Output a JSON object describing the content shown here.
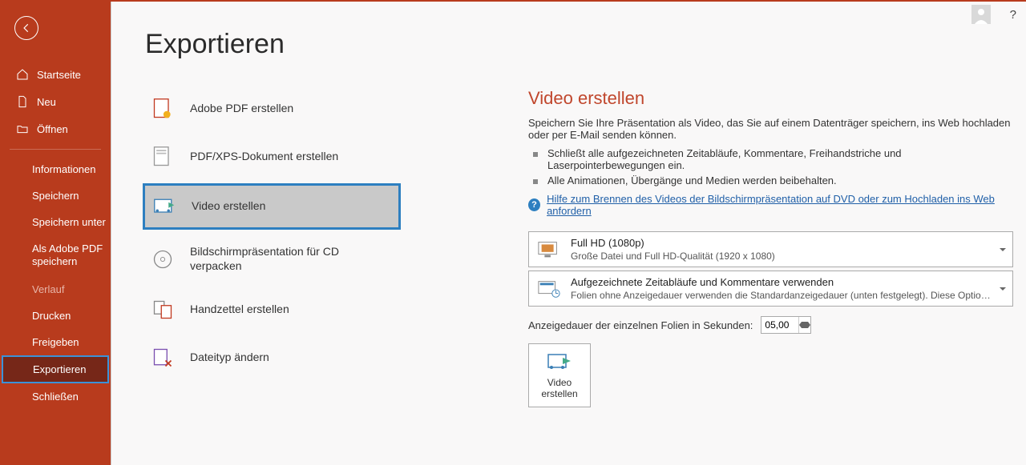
{
  "sidebar": {
    "items": [
      {
        "label": "Startseite"
      },
      {
        "label": "Neu"
      },
      {
        "label": "Öffnen"
      },
      {
        "label": "Informationen"
      },
      {
        "label": "Speichern"
      },
      {
        "label": "Speichern unter"
      },
      {
        "label": "Als Adobe PDF speichern"
      },
      {
        "label": "Verlauf"
      },
      {
        "label": "Drucken"
      },
      {
        "label": "Freigeben"
      },
      {
        "label": "Exportieren"
      },
      {
        "label": "Schließen"
      }
    ]
  },
  "page": {
    "title": "Exportieren"
  },
  "exportOptions": [
    {
      "label": "Adobe PDF erstellen"
    },
    {
      "label": "PDF/XPS-Dokument erstellen"
    },
    {
      "label": "Video erstellen"
    },
    {
      "label": "Bildschirmpräsentation für CD verpacken"
    },
    {
      "label": "Handzettel erstellen"
    },
    {
      "label": "Dateityp ändern"
    }
  ],
  "panel": {
    "heading": "Video erstellen",
    "intro": "Speichern Sie Ihre Präsentation als Video, das Sie auf einem Datenträger speichern, ins Web hochladen oder per E-Mail senden können.",
    "bullet1": "Schließt alle aufgezeichneten Zeitabläufe, Kommentare, Freihandstriche und Laserpointerbewegungen ein.",
    "bullet2": "Alle Animationen, Übergänge und Medien werden beibehalten.",
    "helpLink": "Hilfe zum Brennen des Videos der Bildschirmpräsentation auf DVD oder zum Hochladen ins Web anfordern",
    "quality": {
      "title": "Full HD (1080p)",
      "sub": "Große Datei und Full HD-Qualität (1920 x 1080)"
    },
    "timings": {
      "title": "Aufgezeichnete Zeitabläufe und Kommentare verwenden",
      "sub": "Folien ohne Anzeigedauer verwenden die Standardanzeigedauer (unten festgelegt). Diese Option gilt auch für Freihand und Laserp..."
    },
    "durationLabel": "Anzeigedauer der einzelnen Folien in Sekunden:",
    "durationValue": "05,00",
    "createLabel": "Video erstellen"
  },
  "help": "?"
}
